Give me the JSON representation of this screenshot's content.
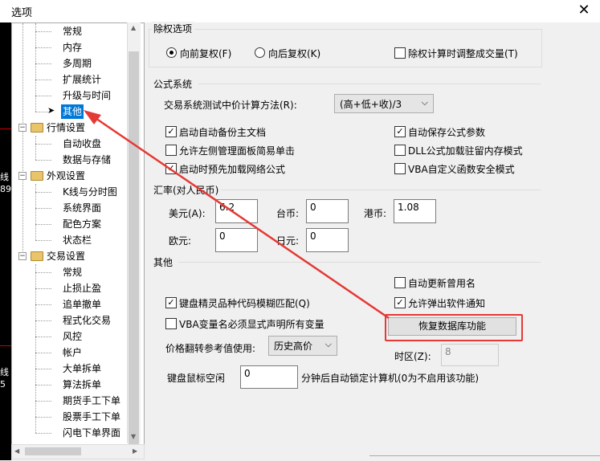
{
  "window": {
    "title": "选项",
    "close_symbol": "✕"
  },
  "background": {
    "texts": [
      "线",
      "89",
      "线",
      "5"
    ]
  },
  "tree": {
    "items": [
      {
        "label": "常规"
      },
      {
        "label": "内存"
      },
      {
        "label": "多周期"
      },
      {
        "label": "扩展统计"
      },
      {
        "label": "升级与时间"
      },
      {
        "label": "其他"
      },
      {
        "label": "行情设置"
      },
      {
        "label": "自动收盘"
      },
      {
        "label": "数据与存储"
      },
      {
        "label": "外观设置"
      },
      {
        "label": "K线与分时图"
      },
      {
        "label": "系统界面"
      },
      {
        "label": "配色方案"
      },
      {
        "label": "状态栏"
      },
      {
        "label": "交易设置"
      },
      {
        "label": "常规"
      },
      {
        "label": "止损止盈"
      },
      {
        "label": "追单撤单"
      },
      {
        "label": "程式化交易"
      },
      {
        "label": "风控"
      },
      {
        "label": "帐户"
      },
      {
        "label": "大单拆单"
      },
      {
        "label": "算法拆单"
      },
      {
        "label": "期货手工下单"
      },
      {
        "label": "股票手工下单"
      },
      {
        "label": "闪电下单界面"
      }
    ]
  },
  "exright": {
    "title": "除权选项",
    "forward": "向前复权(F)",
    "backward": "向后复权(K)",
    "adjust_volume": "除权计算时调整成交量(T)"
  },
  "formula": {
    "title": "公式系统",
    "method_label": "交易系统测试中价计算方法(R):",
    "method_value": "(高+低+收)/3",
    "auto_backup": "启动自动备份主文档",
    "auto_save_params": "自动保存公式参数",
    "left_panel_click": "允许左侧管理面板简易单击",
    "dll_resident": "DLL公式加载驻留内存模式",
    "preload_network": "启动时预先加载网络公式",
    "vba_safe": "VBA自定义函数安全模式"
  },
  "rates": {
    "title": "汇率(对人民币)",
    "usd_label": "美元(A):",
    "usd_value": "6.2",
    "twd_label": "台币:",
    "twd_value": "0",
    "hkd_label": "港币:",
    "hkd_value": "1.08",
    "eur_label": "欧元:",
    "eur_value": "0",
    "jpy_label": "日元:",
    "jpy_value": "0"
  },
  "other": {
    "title": "其他",
    "auto_update_name": "自动更新曾用名",
    "keyboard_fuzzy": "键盘精灵品种代码模糊匹配(Q)",
    "allow_popup": "允许弹出软件通知",
    "vba_declare": "VBA变量名必须显式声明所有变量",
    "restore_button": "恢复数据库功能",
    "price_flip_label": "价格翻转参考值使用:",
    "price_flip_value": "历史高价",
    "timezone_label": "时区(Z):",
    "timezone_value": "8",
    "idle_label": "键盘鼠标空闲",
    "idle_value": "0",
    "idle_suffix": "分钟后自动锁定计算机(0为不启用该功能)"
  },
  "colors": {
    "selection": "#0078d7",
    "annotation": "#e53935"
  }
}
